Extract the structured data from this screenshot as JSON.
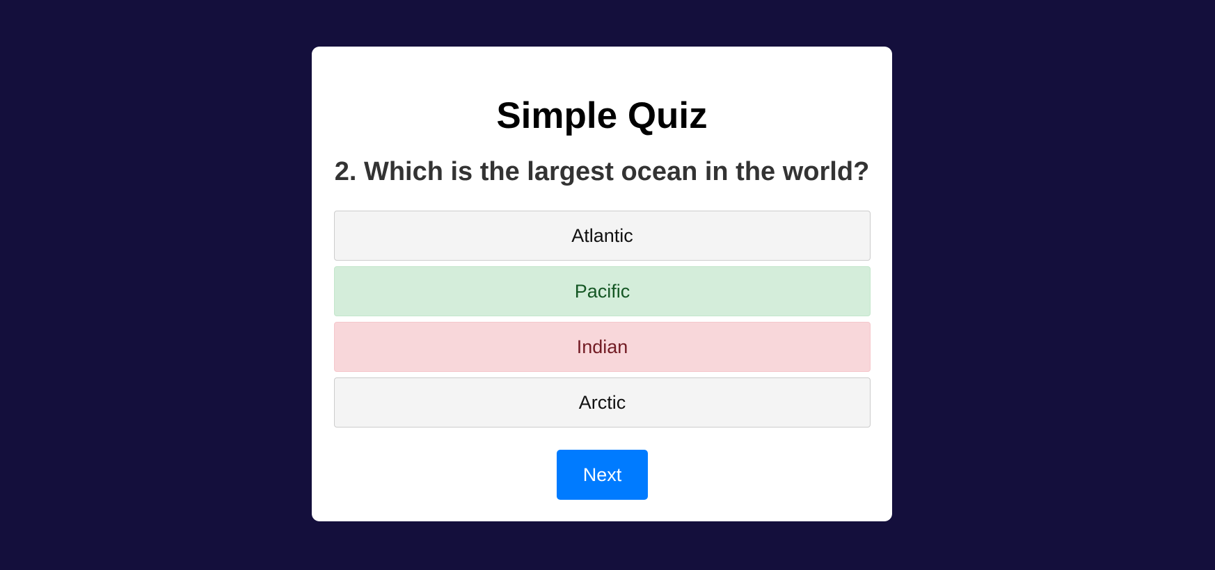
{
  "quiz": {
    "title": "Simple Quiz",
    "question": "2. Which is the largest ocean in the world?",
    "answers": [
      {
        "label": "Atlantic",
        "state": "neutral"
      },
      {
        "label": "Pacific",
        "state": "correct"
      },
      {
        "label": "Indian",
        "state": "wrong"
      },
      {
        "label": "Arctic",
        "state": "neutral"
      }
    ],
    "next_label": "Next"
  },
  "colors": {
    "background": "#140f3c",
    "card": "#ffffff",
    "correct_bg": "#d4edda",
    "wrong_bg": "#f8d7da",
    "neutral_bg": "#f4f4f4",
    "primary_button": "#007bff"
  }
}
